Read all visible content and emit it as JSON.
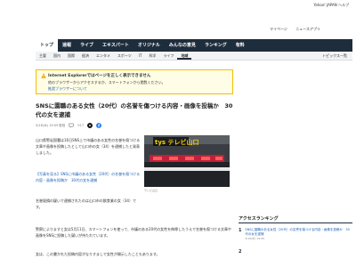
{
  "header": {
    "top_links": "Yahoo! JAPAN ヘルプ",
    "right_links": [
      "マイページ",
      "ニュースアプリ"
    ]
  },
  "nav": {
    "main": [
      "トップ",
      "速報",
      "ライブ",
      "エキスパート",
      "オリジナル",
      "みんなの意見",
      "ランキング",
      "有料"
    ],
    "sub": [
      "主要",
      "国内",
      "国際",
      "経済",
      "エンタメ",
      "スポーツ",
      "IT",
      "科学",
      "ライフ",
      "地域"
    ],
    "sub_active_index": 9,
    "topics_link": "トピックス一覧"
  },
  "ie_notice": {
    "title": "Internet Explorerではページを正しく表示できません",
    "line2": "他のブラウザーからアクセスするか、スマートフォンから閲覧ください。",
    "link": "推奨ブラウザーについて"
  },
  "article": {
    "headline": "SNSに園職のある女性（20代）の名誉を傷つける内容・画像を投稿か　30代の女を逮捕",
    "meta": "5/16(木) 19:09 配信",
    "comments": "517",
    "p1": "山口県警岩国署は16日SNS上で市議のある女性の名誉を傷つける文章や画像を投稿したとして山口市の女（34）を逮捕したと発表しました。",
    "related": "【写真を見る】SNSに市議のある女性（20代）の名誉を傷つける内容・画像を投稿か　30代の女を逮捕",
    "p2": "名誉毀損の疑いで逮捕されたのは山口市の飲食業の女（34）です。",
    "p3": "警察によりますと女は5月11日、スマートフォンを使って、市議のある20代の女性を侮辱したうえで名誉を傷つける文章や画像をSNSに投稿した疑いが持たれています。",
    "p4": "女は、この書かれた投稿内容がなりすましで女性が開示したこともあります。",
    "photo_logo": "tys テレビ山口",
    "photo_caption": "テレビ山口"
  },
  "sidebar": {
    "title": "アクセスランキング",
    "items": [
      {
        "num": "1",
        "text": "SNSに園職のある女性（20代）の名誉を傷つける内容・画像を投稿か　30代の女を逮捕",
        "time": "5/16(木) 19:09"
      },
      {
        "num": "2",
        "text": "",
        "time": ""
      }
    ]
  },
  "colors": {
    "nav_bg": "#1e2d3c",
    "link": "#1a5fb4",
    "notice_border": "#f0c000",
    "notice_bg": "#fffde6"
  }
}
